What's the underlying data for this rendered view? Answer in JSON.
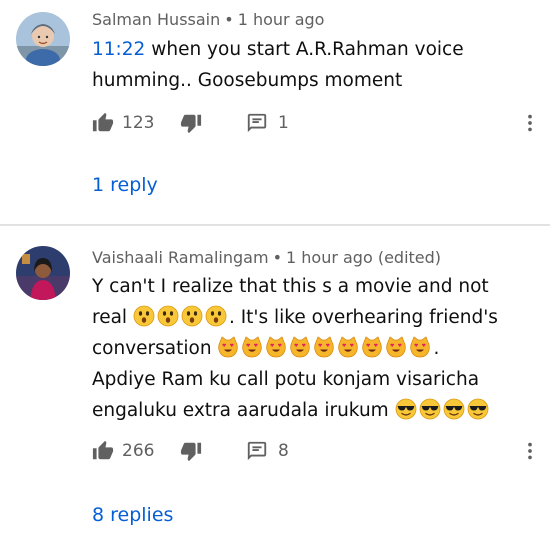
{
  "comments": [
    {
      "author": "Salman Hussain",
      "time": "1 hour ago",
      "timestamp_link": "11:22",
      "text_line1_rest": " when you start A.R.Rahman voice",
      "text_line2": "humming.. Goosebumps moment",
      "likes": "123",
      "reply_count": "1",
      "replies_link": "1 reply"
    },
    {
      "author": "Vaishaali Ramalingam",
      "time": "1 hour ago (edited)",
      "text_line1": "Y can't I realize that this s a movie and not",
      "text_line2_start": "real ",
      "text_line2_end": ". It's like overhearing friend's",
      "text_line3_start": "conversation ",
      "text_line3_end": ".",
      "text_line4": "Apdiye Ram ku call potu konjam visaricha",
      "text_line5": "engaluku extra aarudala irukum ",
      "likes": "266",
      "reply_count": "8",
      "replies_link": "8 replies"
    }
  ],
  "emoji": {
    "astonished_count": 4,
    "heart_eyes_cat_count": 9,
    "sunglasses_count": 4
  },
  "colors": {
    "link": "#065fd4",
    "secondary_text": "#606060",
    "emoji_yellow": "#f9c838"
  },
  "icons": {
    "like": "thumb-up-icon",
    "dislike": "thumb-down-icon",
    "reply": "comment-reply-icon",
    "more": "more-vertical-icon"
  }
}
